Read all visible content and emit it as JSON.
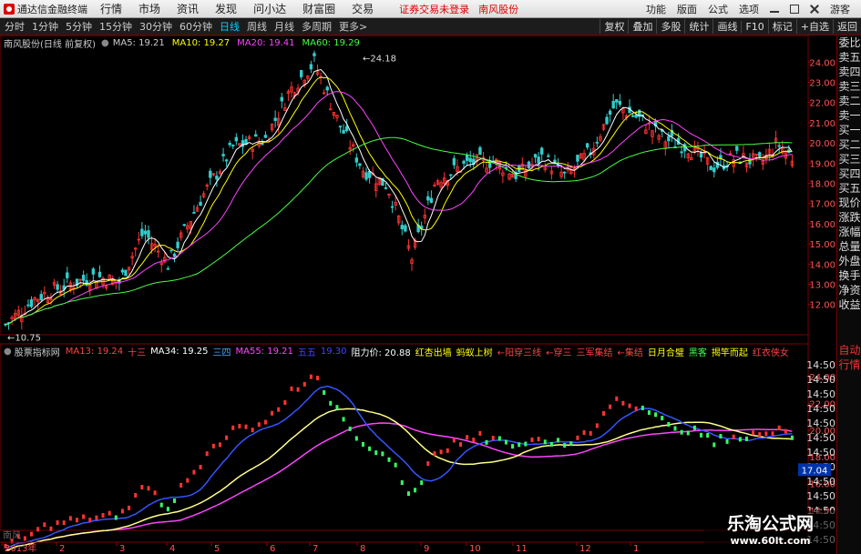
{
  "menubar": {
    "app_title": "通达信金融终端",
    "menus": [
      "行情",
      "市场",
      "资讯",
      "发现",
      "问小达",
      "财富圈",
      "交易"
    ],
    "notice": "证券交易未登录",
    "notice2": "南风股份",
    "right_items": [
      "功能",
      "版面",
      "公式",
      "选项",
      "游客"
    ]
  },
  "tabs": [
    "分时",
    "1分钟",
    "5分钟",
    "15分钟",
    "30分钟",
    "60分钟",
    "日线",
    "周线",
    "月线",
    "多周期",
    "更多>"
  ],
  "active_tab": "日线",
  "toolbar_right": [
    "复权",
    "叠加",
    "多股",
    "统计",
    "画线",
    "F10",
    "标记",
    "+自选",
    "返回"
  ],
  "price_panel": {
    "stock_title": "南风股份(日线 前复权)",
    "ma": [
      {
        "label": "MA5: 19.21",
        "color": "#ffffff"
      },
      {
        "label": "MA10: 19.27",
        "color": "#ffff00"
      },
      {
        "label": "MA20: 19.41",
        "color": "#ff44ff"
      },
      {
        "label": "MA60: 19.29",
        "color": "#44ff44"
      }
    ],
    "y_ticks": [
      "24.00",
      "23.00",
      "22.00",
      "21.00",
      "20.00",
      "19.00",
      "18.00",
      "17.00",
      "16.00",
      "15.00",
      "14.00",
      "13.00",
      "12.00"
    ],
    "high_label": "24.18",
    "low_label": "10.75"
  },
  "indicator_panel": {
    "name": "股票指标网",
    "items": [
      {
        "label": "MA13: 19.24",
        "color": "#ff4444"
      },
      {
        "label": "十三",
        "color": "#ff4444"
      },
      {
        "label": "MA34: 19.25",
        "color": "#ffffff"
      },
      {
        "label": "三四",
        "color": "#44aaff"
      },
      {
        "label": "MA55: 19.21",
        "color": "#ff44ff"
      },
      {
        "label": "五五",
        "color": "#4444ff"
      },
      {
        "label": "19.30",
        "color": "#4444ff"
      },
      {
        "label": "阻力价: 20.88",
        "color": "#ffffff"
      },
      {
        "label": "红杏出墙",
        "color": "#ffff00"
      },
      {
        "label": "蚂蚁上树",
        "color": "#ffff00"
      },
      {
        "label": "←阳穿三线",
        "color": "#ff4444"
      },
      {
        "label": "←穿三",
        "color": "#ff4444"
      },
      {
        "label": "三军集结",
        "color": "#ff4444"
      },
      {
        "label": "←集结",
        "color": "#ff4444"
      },
      {
        "label": "日月合璧",
        "color": "#ffff00"
      },
      {
        "label": "黑客",
        "color": "#44ff44"
      },
      {
        "label": "揭竿而起",
        "color": "#ffff00"
      },
      {
        "label": "红衣侠女",
        "color": "#ff4444"
      }
    ],
    "y_ticks": [
      "24.00",
      "22.00",
      "20.00",
      "18.00",
      "16.00",
      "14.00"
    ],
    "right_axis_labels": [
      "14:50",
      "14:50",
      "14:50",
      "14:50",
      "14:50",
      "14:50",
      "14:50",
      "14:50",
      "14:50",
      "14:50",
      "14:50",
      "14:50",
      "14:50"
    ],
    "current_price": "17.04",
    "bottom_left_label": "南风"
  },
  "sidebar": {
    "items": [
      "委比",
      "卖五",
      "卖四",
      "卖三",
      "卖二",
      "卖一",
      "买一",
      "买二",
      "买三",
      "买四",
      "买五",
      "现价",
      "涨跌",
      "涨幅",
      "总量",
      "外盘",
      "换手",
      "净资",
      "收益"
    ],
    "bottom_items": [
      "自动",
      "行情"
    ]
  },
  "xaxis": {
    "labels": [
      "2013年",
      "2",
      "3",
      "4",
      "5",
      "6",
      "7",
      "8",
      "9",
      "10",
      "11",
      "12",
      "1"
    ]
  },
  "watermark": {
    "line1": "乐淘公式网",
    "line2": "www.60lt.com"
  },
  "colors": {
    "up": "#ff3333",
    "down": "#33cccc",
    "bg": "#000000",
    "grid": "#7a0000"
  }
}
